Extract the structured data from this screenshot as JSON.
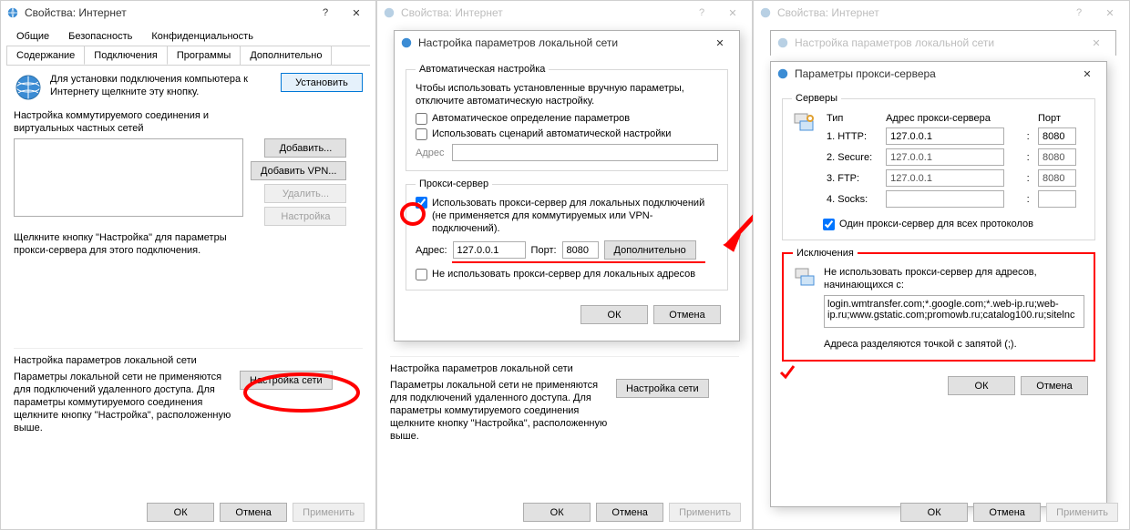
{
  "win1": {
    "title": "Свойства: Интернет",
    "tabs_row1": [
      "Общие",
      "Безопасность",
      "Конфиденциальность"
    ],
    "tabs_row2": [
      "Содержание",
      "Подключения",
      "Программы",
      "Дополнительно"
    ],
    "active_tab": "Подключения",
    "setup_text": "Для установки подключения компьютера к Интернету щелкните эту кнопку.",
    "setup_btn": "Установить",
    "dial_label": "Настройка коммутируемого соединения и виртуальных частных сетей",
    "add_btn": "Добавить...",
    "add_vpn_btn": "Добавить VPN...",
    "del_btn": "Удалить...",
    "settings_btn": "Настройка",
    "proxy_note": "Щелкните кнопку \"Настройка\" для параметры прокси-сервера для этого подключения.",
    "lan_header": "Настройка параметров локальной сети",
    "lan_text": "Параметры локальной сети не применяются для подключений удаленного доступа. Для параметры коммутируемого соединения щелкните кнопку \"Настройка\", расположенную выше.",
    "lan_btn": "Настройка сети",
    "ok": "ОК",
    "cancel": "Отмена",
    "apply": "Применить"
  },
  "win2": {
    "title": "Свойства: Интернет",
    "dlg_title": "Настройка параметров локальной сети",
    "auto_legend": "Автоматическая настройка",
    "auto_note": "Чтобы использовать установленные вручную параметры, отключите автоматическую настройку.",
    "cb_auto": "Автоматическое определение параметров",
    "cb_script": "Использовать сценарий автоматической настройки",
    "addr_label": "Адрес",
    "proxy_legend": "Прокси-сервер",
    "cb_useproxy": "Использовать прокси-сервер для локальных подключений (не применяется для коммутируемых или VPN-подключений).",
    "addr2_label": "Адрес:",
    "addr2_val": "127.0.0.1",
    "port_label": "Порт:",
    "port_val": "8080",
    "adv_btn": "Дополнительно",
    "cb_bypass": "Не использовать прокси-сервер для локальных адресов",
    "ok": "ОК",
    "cancel": "Отмена",
    "lan_header": "Настройка параметров локальной сети",
    "lan_text": "Параметры локальной сети не применяются для подключений удаленного доступа. Для параметры коммутируемого соединения щелкните кнопку \"Настройка\", расположенную выше.",
    "lan_btn": "Настройка сети",
    "fok": "ОК",
    "fcancel": "Отмена",
    "fapply": "Применить"
  },
  "win3": {
    "title": "Свойства: Интернет",
    "dlg_title1": "Настройка параметров локальной сети",
    "dlg_title2": "Параметры прокси-сервера",
    "srv_legend": "Серверы",
    "col_type": "Тип",
    "col_addr": "Адрес прокси-сервера",
    "col_port": "Порт",
    "rows": [
      {
        "type": "1. HTTP:",
        "addr": "127.0.0.1",
        "port": "8080"
      },
      {
        "type": "2. Secure:",
        "addr": "127.0.0.1",
        "port": "8080"
      },
      {
        "type": "3. FTP:",
        "addr": "127.0.0.1",
        "port": "8080"
      },
      {
        "type": "4. Socks:",
        "addr": "",
        "port": ""
      }
    ],
    "cb_same": "Один прокси-сервер для всех протоколов",
    "exc_legend": "Исключения",
    "exc_label": "Не использовать прокси-сервер для адресов, начинающихся с:",
    "exc_val": "login.wmtransfer.com;*.google.com;*.web-ip.ru;web-ip.ru;www.gstatic.com;promowb.ru;catalog100.ru;sitelnc",
    "exc_note": "Адреса разделяются точкой с запятой (;).",
    "ok": "ОК",
    "cancel": "Отмена",
    "fok": "ОК",
    "fcancel": "Отмена",
    "fapply": "Применить"
  }
}
